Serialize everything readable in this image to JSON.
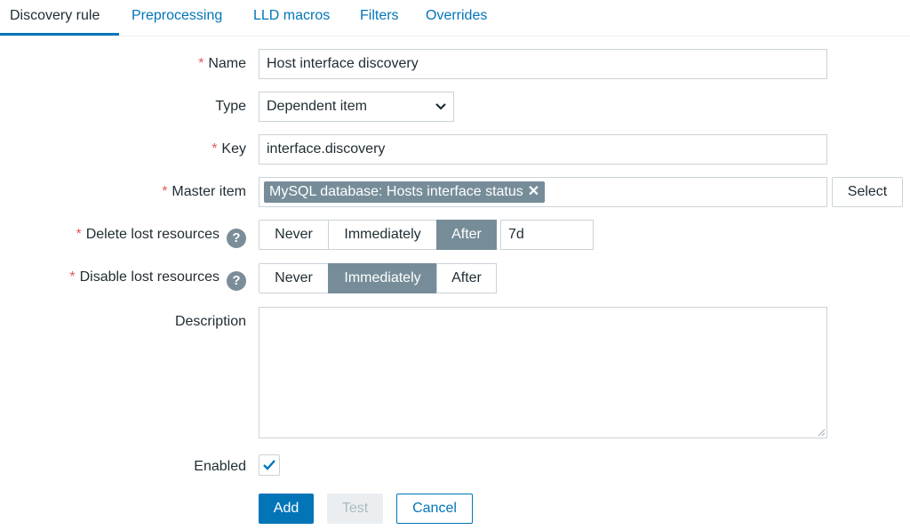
{
  "tabs": [
    {
      "label": "Discovery rule",
      "active": true
    },
    {
      "label": "Preprocessing",
      "active": false
    },
    {
      "label": "LLD macros",
      "active": false
    },
    {
      "label": "Filters",
      "active": false
    },
    {
      "label": "Overrides",
      "active": false
    }
  ],
  "form": {
    "required_mark": "*",
    "name": {
      "label": "Name",
      "value": "Host interface discovery"
    },
    "type": {
      "label": "Type",
      "value": "Dependent item"
    },
    "key": {
      "label": "Key",
      "value": "interface.discovery"
    },
    "master_item": {
      "label": "Master item",
      "tag": "MySQL database: Hosts interface status",
      "remove": "✕",
      "select_label": "Select"
    },
    "delete_lost": {
      "label": "Delete lost resources",
      "help": "?",
      "options": [
        "Never",
        "Immediately",
        "After"
      ],
      "selected": "After",
      "period": "7d"
    },
    "disable_lost": {
      "label": "Disable lost resources",
      "help": "?",
      "options": [
        "Never",
        "Immediately",
        "After"
      ],
      "selected": "Immediately"
    },
    "description": {
      "label": "Description",
      "value": ""
    },
    "enabled": {
      "label": "Enabled",
      "checked": true
    }
  },
  "buttons": {
    "add": "Add",
    "test": "Test",
    "cancel": "Cancel"
  },
  "colors": {
    "accent": "#0275b8",
    "required": "#e45959",
    "segment_active": "#768d99"
  }
}
